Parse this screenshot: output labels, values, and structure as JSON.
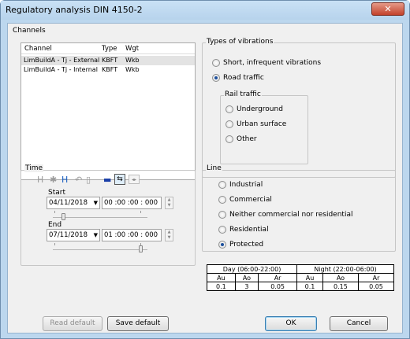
{
  "window": {
    "title": "Regulatory analysis DIN 4150-2",
    "close_glyph": "✕"
  },
  "channels": {
    "group_label": "Channels",
    "columns": [
      "Channel",
      "Type",
      "Wgt"
    ],
    "rows": [
      {
        "channel": "LimBuildA - Tj - External",
        "type": "KBFT",
        "wgt": "Wkb",
        "selected": true
      },
      {
        "channel": "LimBuildA - Tj - Internal",
        "type": "KBFT",
        "wgt": "Wkb",
        "selected": false
      }
    ]
  },
  "vibrations": {
    "group_label": "Types of vibrations",
    "short": "Short, infrequent vibrations",
    "road": "Road traffic",
    "selected": "road",
    "rail": {
      "group_label": "Rail traffic",
      "underground": "Underground",
      "urban": "Urban surface",
      "other": "Other"
    }
  },
  "time": {
    "group_label": "Time",
    "start_label": "Start",
    "start_date": "04/11/2018",
    "start_time": "00 :00 :00 : 000",
    "end_label": "End",
    "end_date": "07/11/2018",
    "end_time": "01 :00 :00 : 000",
    "start_slider_fraction": 0.12,
    "end_slider_fraction": 0.93
  },
  "line": {
    "group_label": "Line",
    "options": [
      "Industrial",
      "Commercial",
      "Neither commercial nor residential",
      "Residential",
      "Protected"
    ],
    "selected": "Protected"
  },
  "limits": {
    "day_header": "Day (06:00-22:00)",
    "night_header": "Night (22:00-06:00)",
    "cols": [
      "Au",
      "Ao",
      "Ar",
      "Au",
      "Ao",
      "Ar"
    ],
    "values": [
      "0.1",
      "3",
      "0.05",
      "0.1",
      "0.15",
      "0.05"
    ]
  },
  "buttons": {
    "read_default": "Read default",
    "save_default": "Save default",
    "ok": "OK",
    "cancel": "Cancel"
  },
  "colors": {
    "frame": "#bcd7ee",
    "close": "#c3412b",
    "radio_dot": "#1c4f9c"
  }
}
